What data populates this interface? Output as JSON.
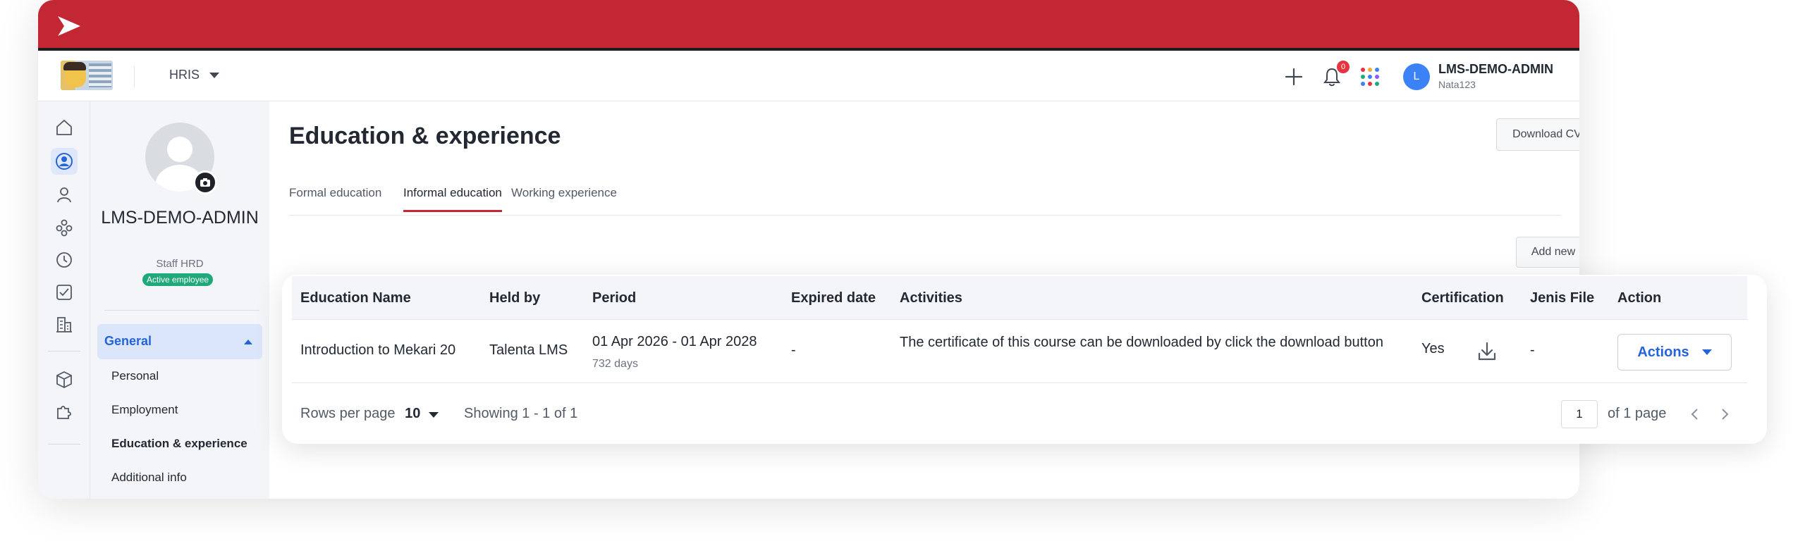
{
  "header": {
    "module": "HRIS",
    "notification_count": "0",
    "user": {
      "initial": "L",
      "name": "LMS-DEMO-ADMIN",
      "username": "Nata123"
    }
  },
  "profile": {
    "name": "LMS-DEMO-ADMIN",
    "role": "Staff HRD",
    "status": "Active employee",
    "menu_group": "General",
    "menu_items": [
      "Personal",
      "Employment",
      "Education & experience",
      "Additional info"
    ]
  },
  "main": {
    "title": "Education & experience",
    "download_cv": "Download CV",
    "tabs": [
      "Formal education",
      "Informal education",
      "Working experience"
    ],
    "active_tab": "Informal education",
    "add_new": "Add new"
  },
  "table": {
    "columns": [
      "Education Name",
      "Held by",
      "Period",
      "Expired date",
      "Activities",
      "Certification",
      "Jenis File",
      "Action"
    ],
    "rows": [
      {
        "education_name": "Introduction to Mekari 20",
        "held_by": "Talenta LMS",
        "period": "01 Apr 2026 - 01 Apr 2028",
        "period_days": "732 days",
        "expired_date": "-",
        "activities": "The certificate of this course can be downloaded by click the download button",
        "certification": "Yes",
        "jenis_file": "-",
        "action": "Actions"
      }
    ],
    "pagination": {
      "rows_per_page_label": "Rows per page",
      "rows_per_page": "10",
      "showing": "Showing 1 - 1 of 1",
      "current_page": "1",
      "of_pages": "of 1 page"
    }
  },
  "colors": {
    "brand": "#c32734",
    "accent": "#2563d9",
    "status_green": "#1fa87a"
  },
  "icons": [
    "play-logo-icon",
    "plus-icon",
    "bell-icon",
    "apps-grid-icon",
    "home-icon",
    "user-circle-icon",
    "person-icon",
    "org-icon",
    "clock-icon",
    "checklist-icon",
    "building-icon",
    "cube-icon",
    "puzzle-icon",
    "camera-icon",
    "download-icon",
    "chevron-left-icon",
    "chevron-right-icon"
  ]
}
